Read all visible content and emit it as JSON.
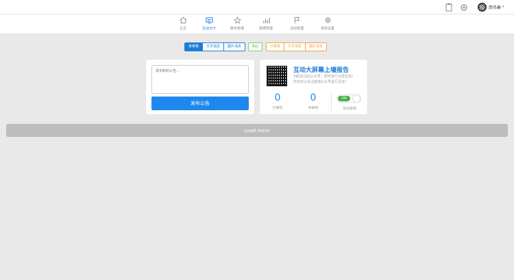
{
  "topbar": {
    "icons": [
      "clipboard-icon",
      "gear-icon"
    ],
    "user_name": "西伟秦",
    "caret": "▾"
  },
  "nav": {
    "items": [
      {
        "label": "主页",
        "icon": "home-icon",
        "active": false
      },
      {
        "label": "互动大厅",
        "icon": "display-icon",
        "active": true
      },
      {
        "label": "聊天管理",
        "icon": "star-icon",
        "active": false
      },
      {
        "label": "数据管理",
        "icon": "bar-chart-icon",
        "active": false
      },
      {
        "label": "活动管理",
        "icon": "flag-icon",
        "active": false
      },
      {
        "label": "系统设置",
        "icon": "gear-icon",
        "active": false
      }
    ]
  },
  "filters": {
    "group1": [
      "未审核",
      "文字消息",
      "图片消息"
    ],
    "group2": [
      "ALL"
    ],
    "group3": [
      "已审核",
      "文字消息",
      "图片消息"
    ]
  },
  "post": {
    "placeholder": "发布新的公告...",
    "button": "发布公告"
  },
  "report": {
    "title": "互动大屏幕上墙报告",
    "desc_line1": "扫码关注此公众号，即可进行大屏互动！",
    "desc_line2": "你也可以关注其他公众号进行互动！",
    "stat1_value": "0",
    "stat1_label": "已审核",
    "stat2_value": "0",
    "stat2_label": "待审核",
    "toggle_label": "ON",
    "toggle_caption": "自动审核",
    "toggle_on": true
  },
  "load_more": "Load more",
  "colors": {
    "accent": "#1e7bd9",
    "button": "#1e88ee",
    "toggle_on": "#46b046",
    "warn": "#f0a24a",
    "ok": "#8cc68c"
  }
}
